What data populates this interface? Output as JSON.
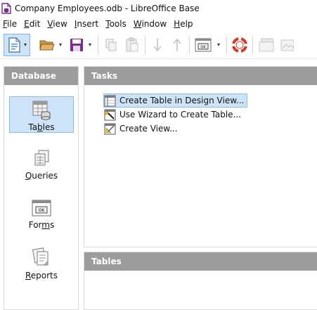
{
  "window": {
    "title": "Company Employees.odb - LibreOffice Base"
  },
  "menu": [
    {
      "label": "File",
      "mnemonic": "F",
      "rest": "ile"
    },
    {
      "label": "Edit",
      "mnemonic": "E",
      "rest": "dit"
    },
    {
      "label": "View",
      "mnemonic": "V",
      "rest": "iew"
    },
    {
      "label": "Insert",
      "mnemonic": "I",
      "rest": "nsert"
    },
    {
      "label": "Tools",
      "mnemonic": "T",
      "rest": "ools"
    },
    {
      "label": "Window",
      "mnemonic": "W",
      "rest": "indow"
    },
    {
      "label": "Help",
      "mnemonic": "H",
      "rest": "elp"
    }
  ],
  "sidebar": {
    "header": "Database",
    "items": [
      {
        "label": "Tables",
        "pre": "Ta",
        "mnemonic": "b",
        "post": "les",
        "icon": "tables-icon",
        "selected": true
      },
      {
        "label": "Queries",
        "pre": "",
        "mnemonic": "Q",
        "post": "ueries",
        "icon": "queries-icon",
        "selected": false
      },
      {
        "label": "Forms",
        "pre": "For",
        "mnemonic": "m",
        "post": "s",
        "icon": "forms-icon",
        "selected": false
      },
      {
        "label": "Reports",
        "pre": "",
        "mnemonic": "R",
        "post": "eports",
        "icon": "reports-icon",
        "selected": false
      }
    ]
  },
  "tasks": {
    "header": "Tasks",
    "items": [
      {
        "label": "Create Table in Design View...",
        "icon": "table-design-icon",
        "highlighted": true
      },
      {
        "label": "Use Wizard to Create Table...",
        "icon": "wizard-icon",
        "highlighted": false
      },
      {
        "label": "Create View...",
        "icon": "create-view-icon",
        "highlighted": false
      }
    ]
  },
  "tables_panel": {
    "header": "Tables"
  },
  "colors": {
    "panel_header": "#9c9c9c",
    "selection": "#cde3f8",
    "selection_border": "#8bbbe8",
    "base_purple": "#7a2b8c"
  }
}
